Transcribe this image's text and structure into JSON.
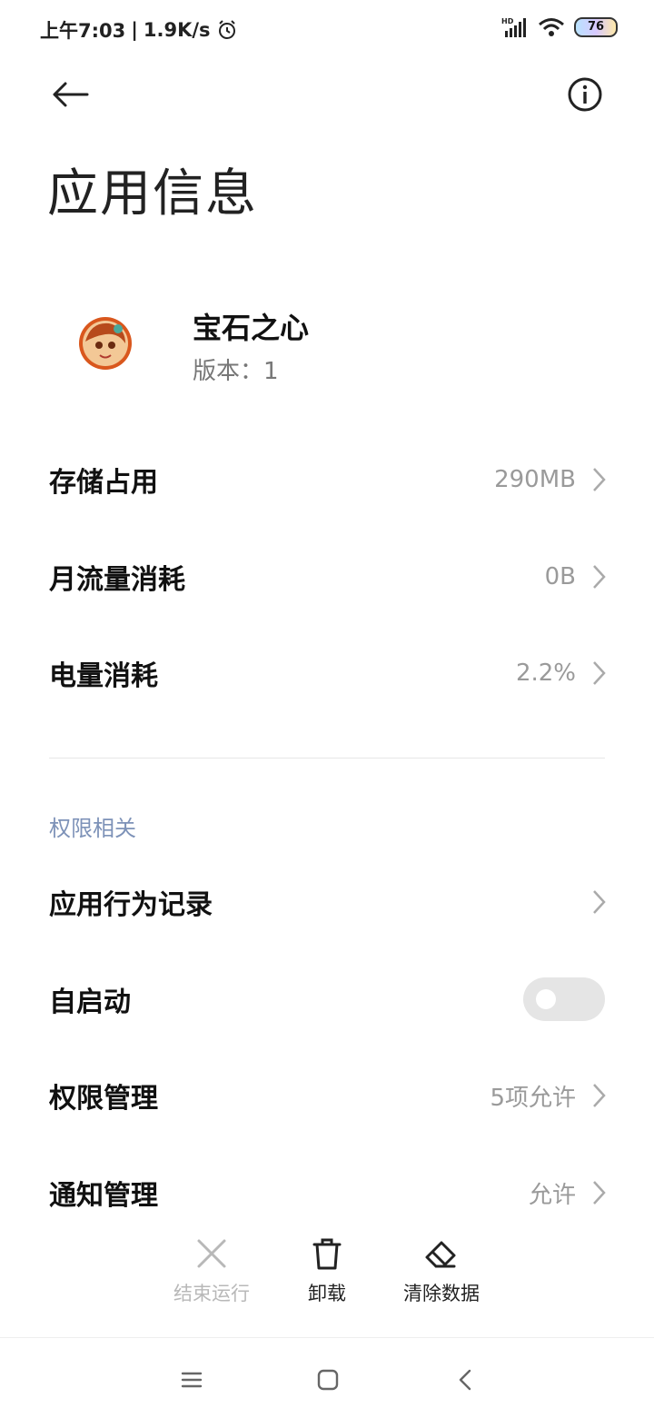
{
  "status_bar": {
    "time": "上午7:03",
    "net_speed": "1.9K/s",
    "battery_level": "76",
    "icons": [
      "alarm-icon",
      "signal-icon",
      "wifi-icon",
      "battery-icon"
    ]
  },
  "header": {
    "back_icon": "back-arrow-icon",
    "info_icon": "info-icon",
    "title": "应用信息"
  },
  "app": {
    "name": "宝石之心",
    "version": "版本：1"
  },
  "usage_rows": [
    {
      "label": "存储占用",
      "value": "290MB"
    },
    {
      "label": "月流量消耗",
      "value": "0B"
    },
    {
      "label": "电量消耗",
      "value": "2.2%"
    }
  ],
  "permissions": {
    "section_title": "权限相关",
    "rows": [
      {
        "label": "应用行为记录",
        "value": ""
      },
      {
        "label": "自启动",
        "value": "",
        "toggle_on": false
      },
      {
        "label": "权限管理",
        "value": "5项允许"
      },
      {
        "label": "通知管理",
        "value": "允许"
      }
    ]
  },
  "actions": [
    {
      "label": "结束运行",
      "icon": "close-icon",
      "enabled": false
    },
    {
      "label": "卸载",
      "icon": "trash-icon",
      "enabled": true
    },
    {
      "label": "清除数据",
      "icon": "eraser-icon",
      "enabled": true
    }
  ],
  "nav": {
    "icons": [
      "menu-icon",
      "home-icon",
      "back-icon"
    ]
  },
  "colors": {
    "accent_section": "#7d92b8",
    "value_gray": "#9a9a9a",
    "disabled": "#b8b8b8"
  }
}
